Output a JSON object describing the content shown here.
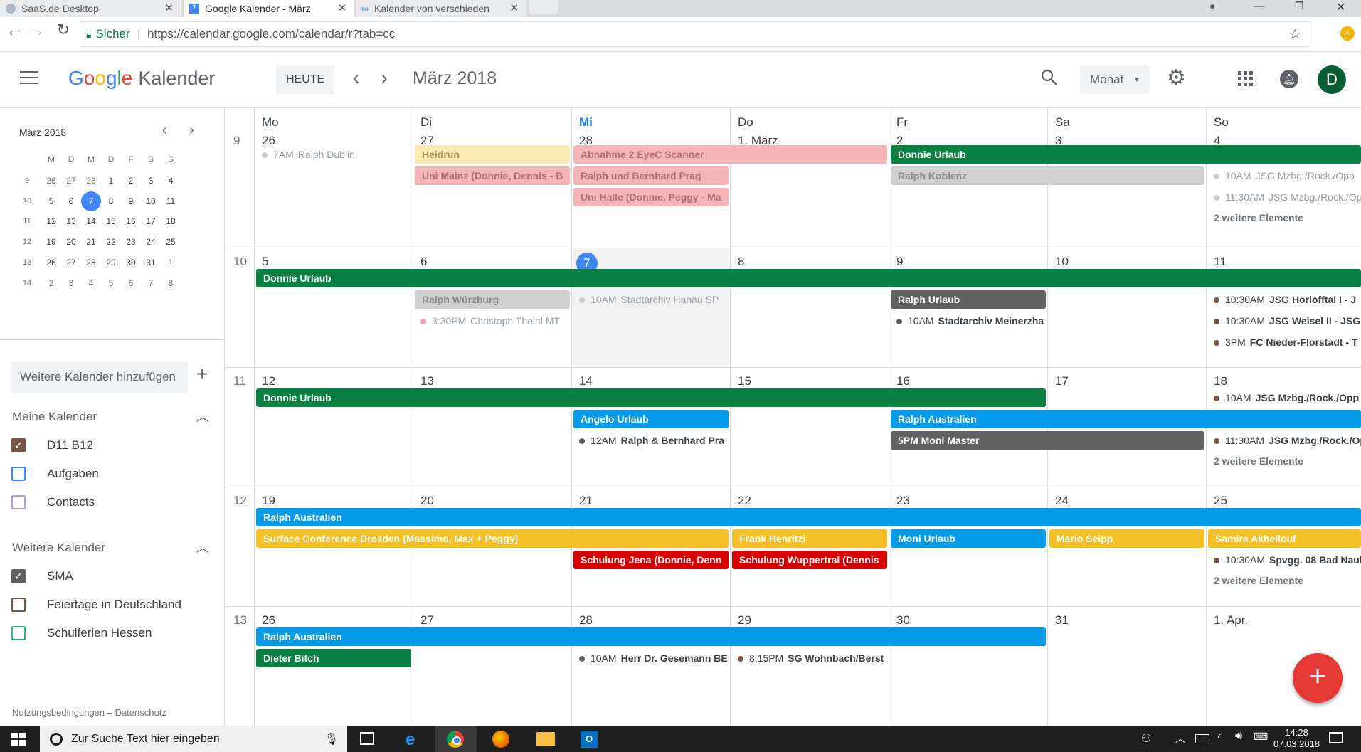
{
  "browser": {
    "tabs": [
      {
        "label": "SaaS.de Desktop",
        "active": false
      },
      {
        "label": "Google Kalender - März",
        "active": true
      },
      {
        "label": "Kalender von verschieden",
        "active": false
      }
    ],
    "secure_label": "Sicher",
    "url": "https://calendar.google.com/calendar/r?tab=cc"
  },
  "header": {
    "logo_google": "Google",
    "logo_product": "Kalender",
    "today_button": "HEUTE",
    "period_title": "März 2018",
    "view_select": "Monat",
    "avatar_letter": "D"
  },
  "sidebar": {
    "mini_title": "März 2018",
    "weekday_letters": [
      "M",
      "D",
      "M",
      "D",
      "F",
      "S",
      "S"
    ],
    "weeks": [
      {
        "wk": "9",
        "days": [
          "26",
          "27",
          "28",
          "1",
          "2",
          "3",
          "4"
        ]
      },
      {
        "wk": "10",
        "days": [
          "5",
          "6",
          "7",
          "8",
          "9",
          "10",
          "11"
        ]
      },
      {
        "wk": "11",
        "days": [
          "12",
          "13",
          "14",
          "15",
          "16",
          "17",
          "18"
        ]
      },
      {
        "wk": "12",
        "days": [
          "19",
          "20",
          "21",
          "22",
          "23",
          "24",
          "25"
        ]
      },
      {
        "wk": "13",
        "days": [
          "26",
          "27",
          "28",
          "29",
          "30",
          "31",
          "1"
        ]
      },
      {
        "wk": "14",
        "days": [
          "2",
          "3",
          "4",
          "5",
          "6",
          "7",
          "8"
        ]
      }
    ],
    "add_calendar_placeholder": "Weitere Kalender hinzufügen",
    "my_calendars_title": "Meine Kalender",
    "my_calendars": [
      {
        "label": "D11 B12",
        "color": "#795548",
        "checked": true
      },
      {
        "label": "Aufgaben",
        "color": "#4285f4",
        "checked": false
      },
      {
        "label": "Contacts",
        "color": "#b39ddb",
        "checked": false
      }
    ],
    "other_calendars_title": "Weitere Kalender",
    "other_calendars": [
      {
        "label": "SMA",
        "color": "#616161",
        "checked": true
      },
      {
        "label": "Feiertage in Deutschland",
        "color": "#795548",
        "checked": false
      },
      {
        "label": "Schulferien Hessen",
        "color": "#33b679",
        "checked": false
      }
    ],
    "footer": "Nutzungsbedingungen – Datenschutz"
  },
  "grid": {
    "weekday_headers": [
      "Mo",
      "Di",
      "Mi",
      "Do",
      "Fr",
      "Sa",
      "So"
    ],
    "weeks": [
      {
        "wk": "9",
        "days": [
          "26",
          "27",
          "28",
          "1. März",
          "2",
          "3",
          "4"
        ]
      },
      {
        "wk": "10",
        "days": [
          "5",
          "6",
          "7",
          "8",
          "9",
          "10",
          "11"
        ]
      },
      {
        "wk": "11",
        "days": [
          "12",
          "13",
          "14",
          "15",
          "16",
          "17",
          "18"
        ]
      },
      {
        "wk": "12",
        "days": [
          "19",
          "20",
          "21",
          "22",
          "23",
          "24",
          "25"
        ]
      },
      {
        "wk": "13",
        "days": [
          "26",
          "27",
          "28",
          "29",
          "30",
          "31",
          "1. Apr."
        ]
      }
    ],
    "today": {
      "week": 1,
      "day": 2
    },
    "chips": [
      {
        "week": 0,
        "slot": 1,
        "start": 1,
        "span": 1,
        "title": "Heidrun",
        "bg": "#fde9b2",
        "fg": "#a78b55",
        "faded": true
      },
      {
        "week": 0,
        "slot": 1,
        "start": 2,
        "span": 2,
        "title": "Abnahme 2 EyeC Scanner",
        "bg": "#f3b5b5",
        "fg": "#b07070",
        "faded": true
      },
      {
        "week": 0,
        "slot": 1,
        "start": 4,
        "span": 3,
        "title": "Donnie Urlaub",
        "bg": "#0b8043",
        "fg": "#ffffff"
      },
      {
        "week": 0,
        "slot": 2,
        "start": 1,
        "span": 1,
        "title": "Uni Mainz (Donnie, Dennis - B",
        "bg": "#f3b5b5",
        "fg": "#b07070",
        "faded": true
      },
      {
        "week": 0,
        "slot": 2,
        "start": 2,
        "span": 1,
        "title": "Ralph und Bernhard Prag",
        "bg": "#f3b5b5",
        "fg": "#b07070",
        "faded": true
      },
      {
        "week": 0,
        "slot": 2,
        "start": 4,
        "span": 2,
        "title": "Ralph Koblenz",
        "bg": "#d0d0d0",
        "fg": "#8a8a8a",
        "faded": true
      },
      {
        "week": 0,
        "slot": 3,
        "start": 2,
        "span": 1,
        "title": "Uni Halle (Donnie, Peggy - Ma",
        "bg": "#f3b5b5",
        "fg": "#b07070",
        "faded": true
      },
      {
        "week": 1,
        "slot": 1,
        "start": 0,
        "span": 7,
        "title": "Donnie Urlaub",
        "bg": "#0b8043",
        "fg": "#ffffff"
      },
      {
        "week": 1,
        "slot": 2,
        "start": 1,
        "span": 1,
        "title": "Ralph Würzburg",
        "bg": "#d0d0d0",
        "fg": "#8a8a8a",
        "faded": true
      },
      {
        "week": 1,
        "slot": 2,
        "start": 4,
        "span": 1,
        "title": "Ralph Urlaub",
        "bg": "#616161",
        "fg": "#ffffff"
      },
      {
        "week": 2,
        "slot": 1,
        "start": 0,
        "span": 5,
        "title": "Donnie Urlaub",
        "bg": "#0b8043",
        "fg": "#ffffff"
      },
      {
        "week": 2,
        "slot": 2,
        "start": 2,
        "span": 1,
        "title": "Angelo Urlaub",
        "bg": "#039be5",
        "fg": "#ffffff"
      },
      {
        "week": 2,
        "slot": 2,
        "start": 4,
        "span": 3,
        "title": "Ralph Australien",
        "bg": "#039be5",
        "fg": "#ffffff"
      },
      {
        "week": 2,
        "slot": 3,
        "start": 4,
        "span": 2,
        "title": "5PM Moni Master",
        "bg": "#616161",
        "fg": "#ffffff"
      },
      {
        "week": 3,
        "slot": 1,
        "start": 0,
        "span": 7,
        "title": "Ralph Australien",
        "bg": "#039be5",
        "fg": "#ffffff"
      },
      {
        "week": 3,
        "slot": 2,
        "start": 0,
        "span": 3,
        "title": "Surface Conference Dresden (Massimo, Max + Peggy)",
        "bg": "#f6bf26",
        "fg": "#ffffff"
      },
      {
        "week": 3,
        "slot": 2,
        "start": 3,
        "span": 1,
        "title": "Frank Henritzi",
        "bg": "#f6bf26",
        "fg": "#ffffff"
      },
      {
        "week": 3,
        "slot": 2,
        "start": 4,
        "span": 1,
        "title": "Moni Urlaub",
        "bg": "#039be5",
        "fg": "#ffffff"
      },
      {
        "week": 3,
        "slot": 2,
        "start": 5,
        "span": 1,
        "title": "Mario Seipp",
        "bg": "#f6bf26",
        "fg": "#ffffff"
      },
      {
        "week": 3,
        "slot": 2,
        "start": 6,
        "span": 1,
        "title": "Samira Akhellouf",
        "bg": "#f6bf26",
        "fg": "#ffffff"
      },
      {
        "week": 3,
        "slot": 3,
        "start": 2,
        "span": 1,
        "title": "Schulung Jena (Donnie, Denn",
        "bg": "#d50000",
        "fg": "#ffffff"
      },
      {
        "week": 3,
        "slot": 3,
        "start": 3,
        "span": 1,
        "title": "Schulung Wuppertral (Dennis",
        "bg": "#d50000",
        "fg": "#ffffff"
      },
      {
        "week": 4,
        "slot": 1,
        "start": 0,
        "span": 5,
        "title": "Ralph Australien",
        "bg": "#039be5",
        "fg": "#ffffff"
      },
      {
        "week": 4,
        "slot": 2,
        "start": 0,
        "span": 1,
        "title": "Dieter Bitch",
        "bg": "#0b8043",
        "fg": "#ffffff"
      }
    ],
    "dot_events": [
      {
        "week": 0,
        "slot": 1,
        "day": 0,
        "time": "7AM",
        "title": "Ralph Dublin",
        "color": "#ccc",
        "past": true
      },
      {
        "week": 0,
        "slot": 2,
        "day": 6,
        "time": "10AM",
        "title": "JSG Mzbg./Rock./Opp",
        "color": "#ccc",
        "past": true
      },
      {
        "week": 0,
        "slot": 3,
        "day": 6,
        "time": "11:30AM",
        "title": "JSG Mzbg./Rock./Opp",
        "color": "#ccc",
        "past": true
      },
      {
        "week": 1,
        "slot": 2,
        "day": 2,
        "time": "10AM",
        "title": "Stadtarchiv Hanau SP",
        "color": "#ccc",
        "past": true
      },
      {
        "week": 1,
        "slot": 2,
        "day": 6,
        "time": "10:30AM",
        "title": "JSG Horlofftal I - J",
        "color": "#795548"
      },
      {
        "week": 1,
        "slot": 3,
        "day": 1,
        "time": "3:30PM",
        "title": "Christoph Theinl MT",
        "color": "#f3a0a0",
        "past": true
      },
      {
        "week": 1,
        "slot": 3,
        "day": 4,
        "time": "10AM",
        "title": "Stadtarchiv Meinerzha",
        "color": "#616161"
      },
      {
        "week": 1,
        "slot": 3,
        "day": 6,
        "time": "10:30AM",
        "title": "JSG Weisel II - JSG",
        "color": "#795548"
      },
      {
        "week": 1,
        "slot": 4,
        "day": 6,
        "time": "3PM",
        "title": "FC Nieder-Florstadt - T",
        "color": "#795548"
      },
      {
        "week": 2,
        "slot": 1,
        "day": 6,
        "time": "10AM",
        "title": "JSG Mzbg./Rock./Opp",
        "color": "#795548"
      },
      {
        "week": 2,
        "slot": 3,
        "day": 2,
        "time": "12AM",
        "title": "Ralph & Bernhard Pra",
        "color": "#616161"
      },
      {
        "week": 2,
        "slot": 3,
        "day": 6,
        "time": "11:30AM",
        "title": "JSG Mzbg./Rock./Opp",
        "color": "#795548"
      },
      {
        "week": 3,
        "slot": 3,
        "day": 6,
        "time": "10:30AM",
        "title": "Spvgg. 08 Bad Nauh",
        "color": "#795548"
      },
      {
        "week": 4,
        "slot": 2,
        "day": 2,
        "time": "10AM",
        "title": "Herr Dr. Gesemann BE",
        "color": "#616161"
      },
      {
        "week": 4,
        "slot": 2,
        "day": 3,
        "time": "8:15PM",
        "title": "SG Wohnbach/Berst",
        "color": "#795548"
      }
    ],
    "more_links": [
      {
        "week": 0,
        "day": 6,
        "slot": 4,
        "label": "2 weitere Elemente"
      },
      {
        "week": 2,
        "day": 6,
        "slot": 4,
        "label": "2 weitere Elemente"
      },
      {
        "week": 3,
        "day": 6,
        "slot": 4,
        "label": "2 weitere Elemente"
      }
    ]
  },
  "fab_label": "+",
  "taskbar": {
    "search_placeholder": "Zur Suche Text hier eingeben",
    "time": "14:28",
    "date": "07.03.2018"
  }
}
